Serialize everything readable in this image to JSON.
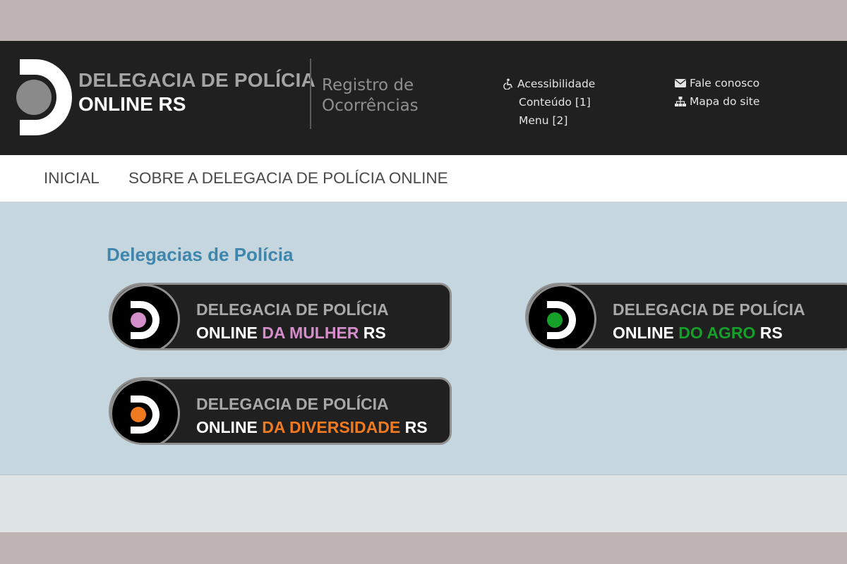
{
  "header": {
    "brand_line1": "DELEGACIA DE POLÍCIA",
    "brand_line2": "ONLINE RS",
    "subtitle_line1": "Registro de",
    "subtitle_line2": "Ocorrências",
    "accessibility": {
      "title": "Acessibilidade",
      "content_link": "Conteúdo [1]",
      "menu_link": "Menu [2]",
      "icon": "wheelchair-icon"
    },
    "contact": {
      "label": "Fale conosco",
      "icon": "envelope-icon"
    },
    "sitemap": {
      "label": "Mapa do site",
      "icon": "sitemap-icon"
    }
  },
  "nav": {
    "items": [
      {
        "label": "INICIAL"
      },
      {
        "label": "SOBRE A DELEGACIA DE POLÍCIA ONLINE"
      }
    ]
  },
  "main": {
    "section_title": "Delegacias de Polícia",
    "delegacias": [
      {
        "line1": "DELEGACIA DE POLÍCIA",
        "prefix": "ONLINE ",
        "highlight": "DA MULHER",
        "suffix": " RS",
        "accent": "#d48fcb"
      },
      {
        "line1": "DELEGACIA DE POLÍCIA",
        "prefix": "ONLINE ",
        "highlight": "DO AGRO",
        "suffix": " RS",
        "accent": "#15a02a"
      },
      {
        "line1": "DELEGACIA DE POLÍCIA",
        "prefix": "ONLINE ",
        "highlight": "DA DIVERSIDADE",
        "suffix": " RS",
        "accent": "#f07a1f"
      }
    ]
  },
  "colors": {
    "header_bg": "#202020",
    "section_title": "#3f86ad",
    "main_bg": "#c5d6de",
    "frame": "#bfb3b3"
  }
}
